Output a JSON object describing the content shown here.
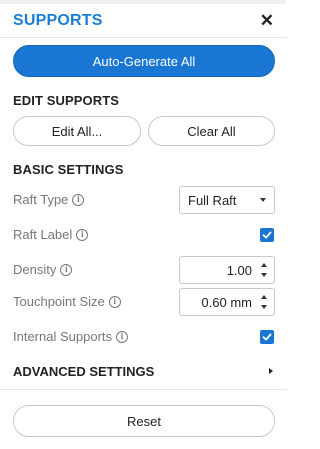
{
  "panel": {
    "title": "SUPPORTS",
    "close_icon": "close-icon"
  },
  "auto_generate": {
    "label": "Auto-Generate All"
  },
  "edit_supports": {
    "heading": "EDIT SUPPORTS",
    "edit_all_label": "Edit All...",
    "clear_all_label": "Clear All"
  },
  "basic_settings": {
    "heading": "BASIC SETTINGS",
    "raft_type": {
      "label": "Raft Type",
      "value": "Full Raft"
    },
    "raft_label": {
      "label": "Raft Label",
      "checked": true
    },
    "density": {
      "label": "Density",
      "value": "1.00"
    },
    "touchpoint_size": {
      "label": "Touchpoint Size",
      "value": "0.60 mm"
    },
    "internal_supports": {
      "label": "Internal Supports",
      "checked": true
    }
  },
  "advanced_settings": {
    "label": "ADVANCED SETTINGS"
  },
  "reset": {
    "label": "Reset"
  },
  "colors": {
    "accent": "#1976d2",
    "title": "#1a7fd4",
    "label_gray": "#777777",
    "border": "#c8c8c8"
  }
}
